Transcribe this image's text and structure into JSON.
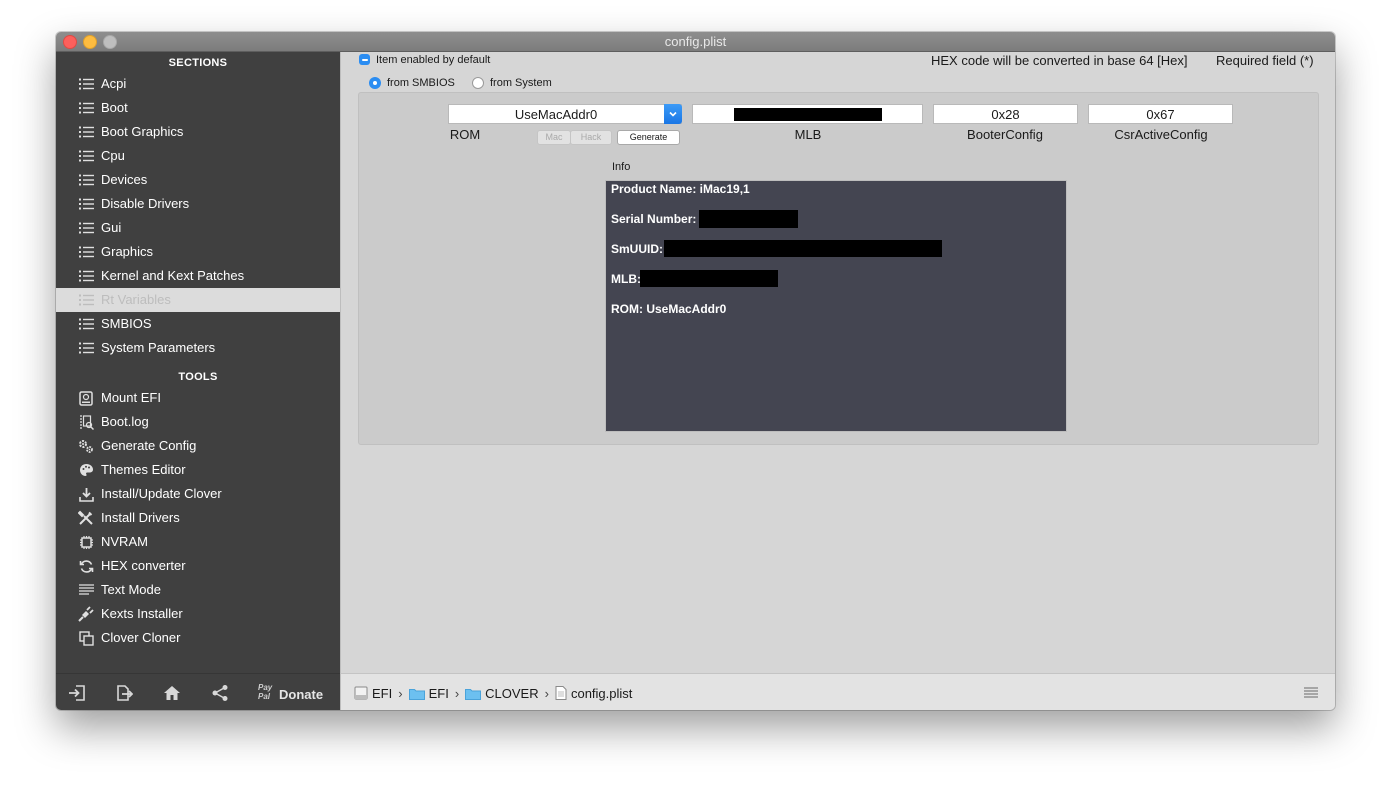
{
  "window": {
    "title": "config.plist"
  },
  "sidebar": {
    "sections_heading": "SECTIONS",
    "sections": [
      {
        "label": "Acpi",
        "icon": "list-icon"
      },
      {
        "label": "Boot",
        "icon": "list-icon"
      },
      {
        "label": "Boot Graphics",
        "icon": "list-icon"
      },
      {
        "label": "Cpu",
        "icon": "list-icon"
      },
      {
        "label": "Devices",
        "icon": "list-icon"
      },
      {
        "label": "Disable Drivers",
        "icon": "list-icon"
      },
      {
        "label": "Gui",
        "icon": "list-icon"
      },
      {
        "label": "Graphics",
        "icon": "list-icon"
      },
      {
        "label": "Kernel and Kext Patches",
        "icon": "list-icon"
      },
      {
        "label": "Rt Variables",
        "icon": "list-icon",
        "selected": true
      },
      {
        "label": "SMBIOS",
        "icon": "list-icon"
      },
      {
        "label": "System Parameters",
        "icon": "list-icon"
      }
    ],
    "tools_heading": "TOOLS",
    "tools": [
      {
        "label": "Mount EFI",
        "icon": "disk-icon"
      },
      {
        "label": "Boot.log",
        "icon": "log-search-icon"
      },
      {
        "label": "Generate Config",
        "icon": "gears-icon"
      },
      {
        "label": "Themes Editor",
        "icon": "palette-icon"
      },
      {
        "label": "Install/Update Clover",
        "icon": "download-icon"
      },
      {
        "label": "Install Drivers",
        "icon": "wrench-screwdriver-icon"
      },
      {
        "label": "NVRAM",
        "icon": "chip-icon"
      },
      {
        "label": "HEX converter",
        "icon": "refresh-icon"
      },
      {
        "label": "Text Mode",
        "icon": "text-lines-icon"
      },
      {
        "label": "Kexts Installer",
        "icon": "plug-icon"
      },
      {
        "label": "Clover Cloner",
        "icon": "copy-icon"
      }
    ],
    "footer": {
      "paypal_top": "Pay",
      "paypal_bottom": "Pal",
      "donate_label": "Donate"
    }
  },
  "main": {
    "checkbox_label": "Item enabled by default",
    "hex_note": "HEX code will be converted in base 64 [Hex]",
    "required_note": "Required field (*)",
    "radio_smbios": "from SMBIOS",
    "radio_system": "from System",
    "rom": {
      "value": "UseMacAddr0",
      "label": "ROM"
    },
    "mlb": {
      "label": "MLB"
    },
    "booter_config": {
      "value": "0x28",
      "label": "BooterConfig"
    },
    "csr_active_config": {
      "value": "0x67",
      "label": "CsrActiveConfig"
    },
    "seg_mac": "Mac",
    "seg_hack": "Hack",
    "generate_label": "Generate",
    "info_label": "Info",
    "info": {
      "product_name": "Product Name: iMac19,1",
      "serial_number": "Serial Number:",
      "smuuid": "SmUUID:",
      "mlb": "MLB:",
      "rom": "ROM: UseMacAddr0"
    }
  },
  "statusbar": {
    "crumbs": [
      "EFI",
      "EFI",
      "CLOVER",
      "config.plist"
    ],
    "separator": "›"
  }
}
